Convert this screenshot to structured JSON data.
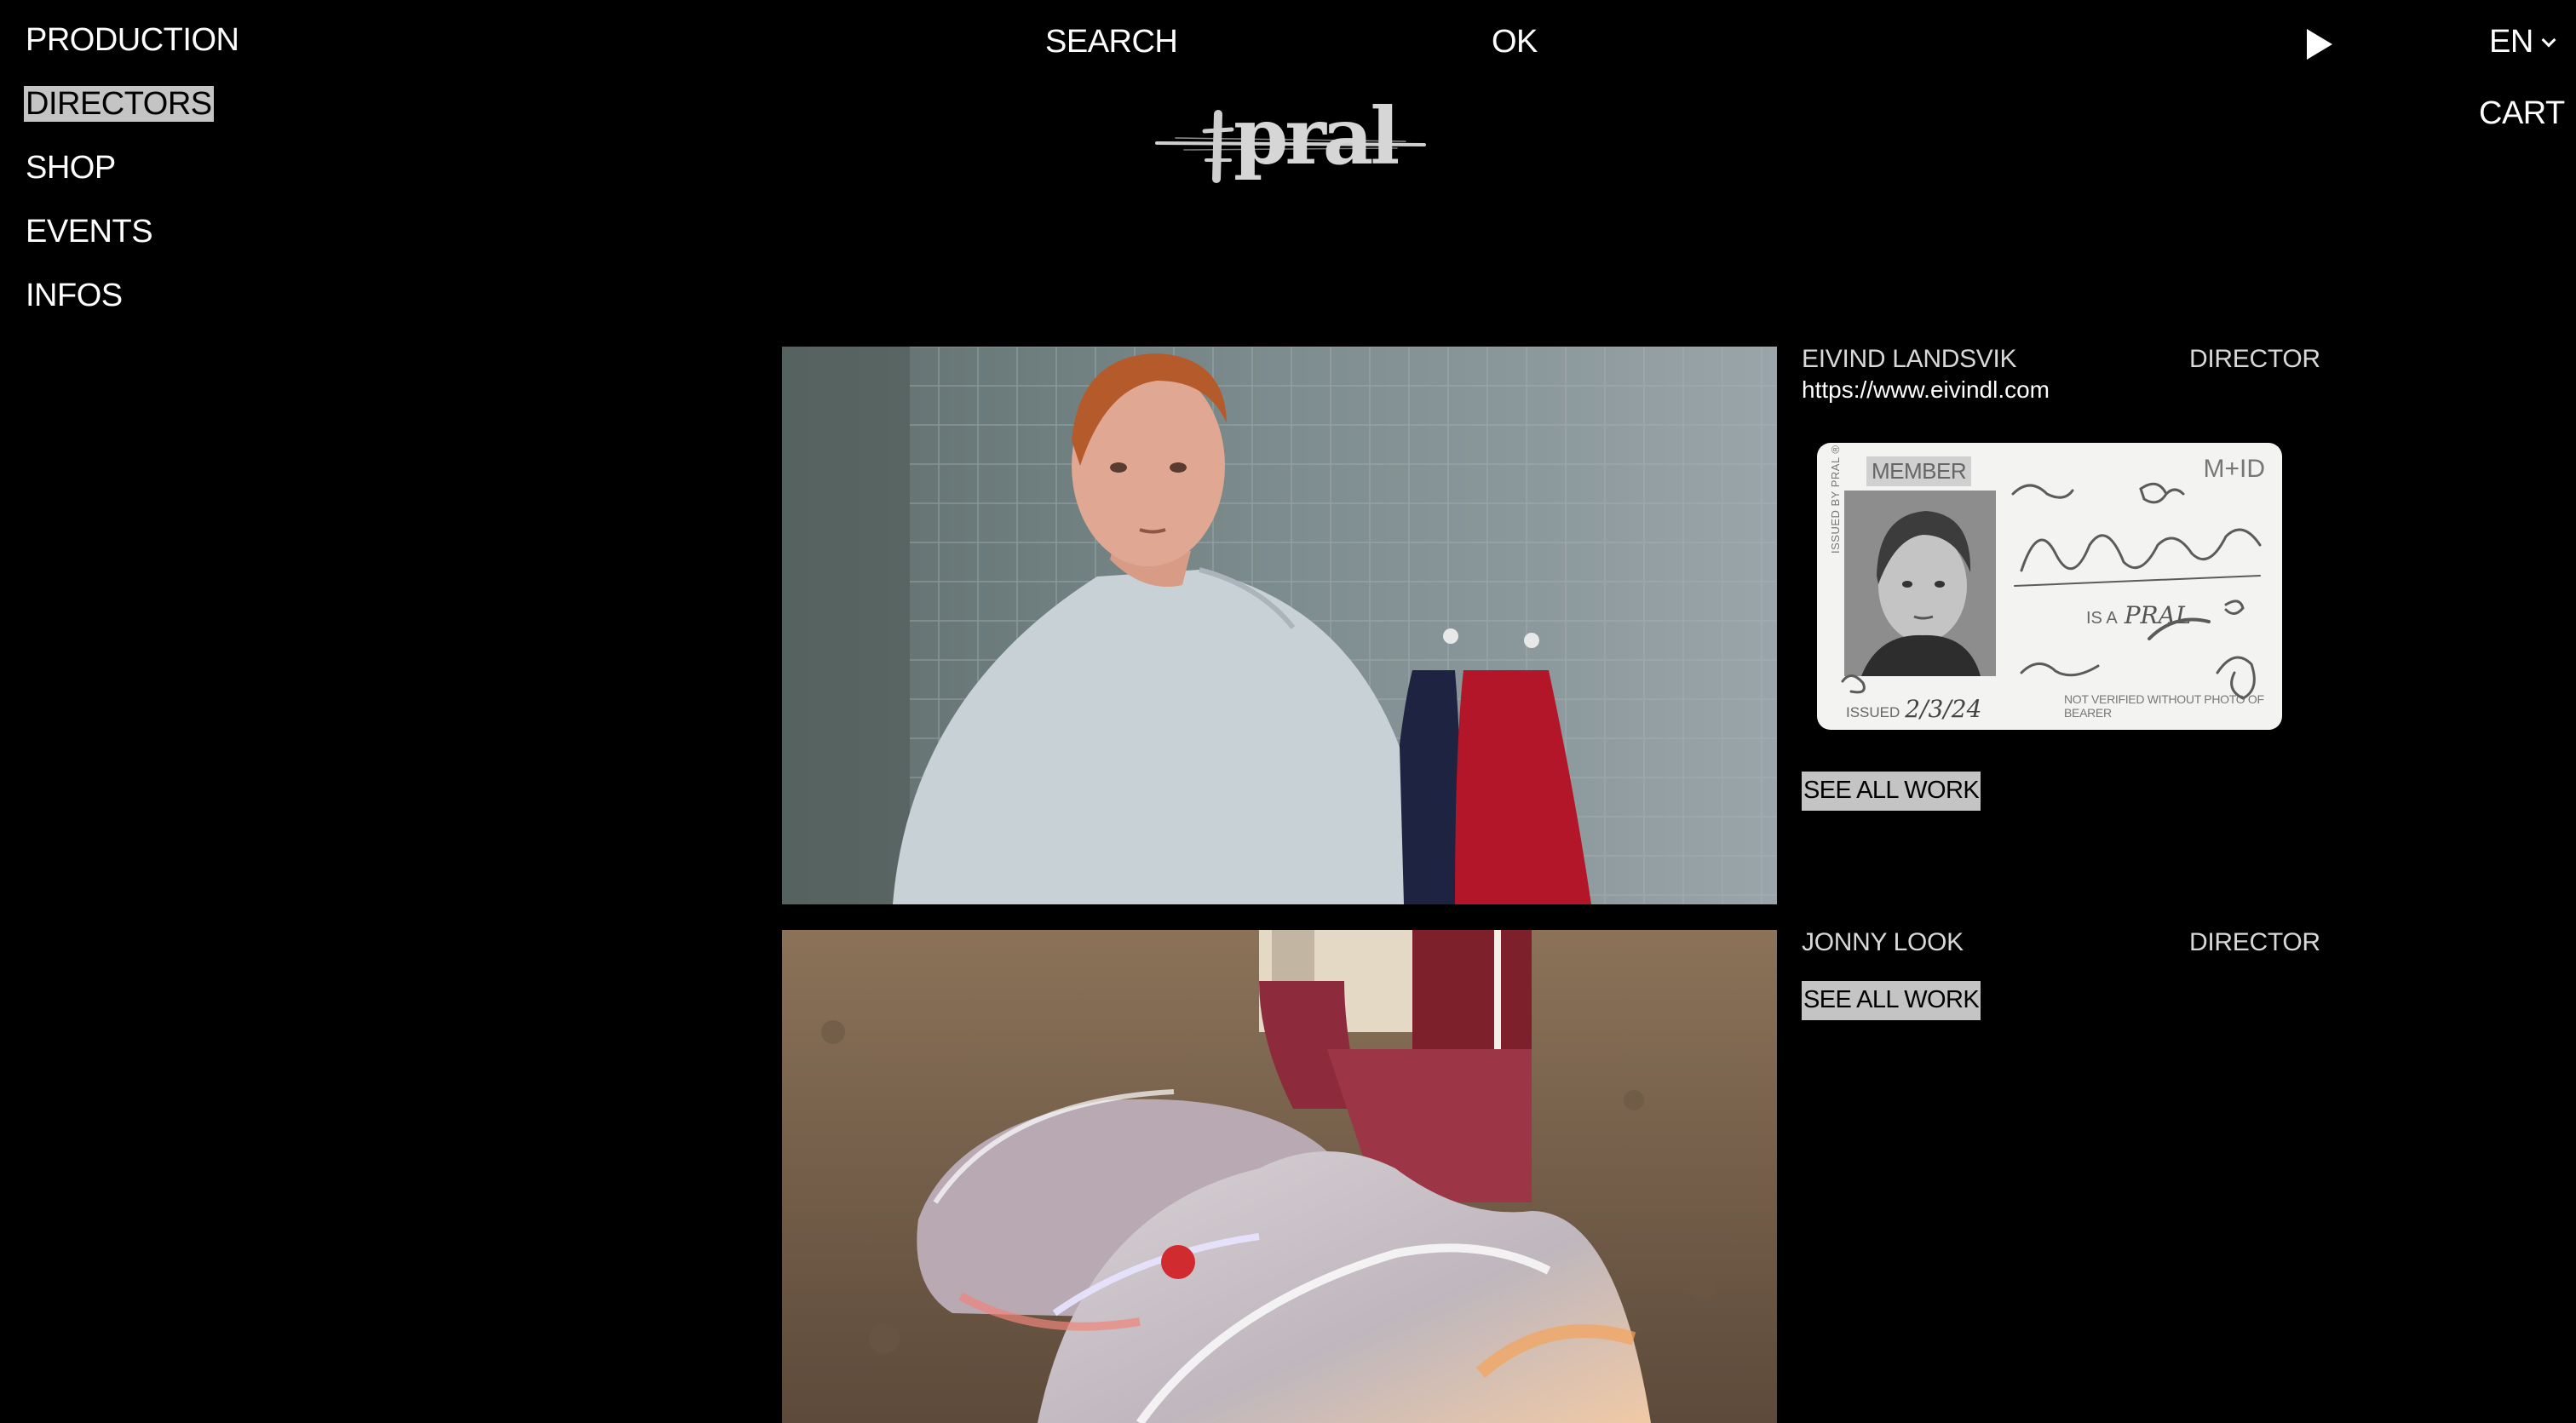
{
  "nav": {
    "items": [
      {
        "label": "PRODUCTION",
        "active": false
      },
      {
        "label": "DIRECTORS",
        "active": true
      },
      {
        "label": "SHOP",
        "active": false
      },
      {
        "label": "EVENTS",
        "active": false
      },
      {
        "label": "INFOS",
        "active": false
      }
    ]
  },
  "header": {
    "search_label": "SEARCH",
    "ok_label": "OK",
    "language": "EN",
    "cart_label": "CART",
    "logo_text": "pral",
    "play_icon": "play-icon"
  },
  "directors": [
    {
      "name": "EIVIND LANDSVIK",
      "role": "DIRECTOR",
      "website": "https://www.eivindl.com",
      "see_all_label": "SEE ALL WORK",
      "id_card": {
        "member_label": "MEMBER",
        "mid_label": "M+ID",
        "issued_by": "ISSUED BY PRAL ®",
        "issued_label": "ISSUED",
        "issued_date": "2/3/24",
        "disclaimer": "NOT VERIFIED WITHOUT PHOTO OF BEARER",
        "is_a_label": "IS A",
        "is_a_value": "PRAL"
      }
    },
    {
      "name": "JONNY LOOK",
      "role": "DIRECTOR",
      "see_all_label": "SEE ALL WORK"
    }
  ],
  "colors": {
    "background": "#000000",
    "text": "#ffffff",
    "highlight": "#c4c4c4"
  }
}
